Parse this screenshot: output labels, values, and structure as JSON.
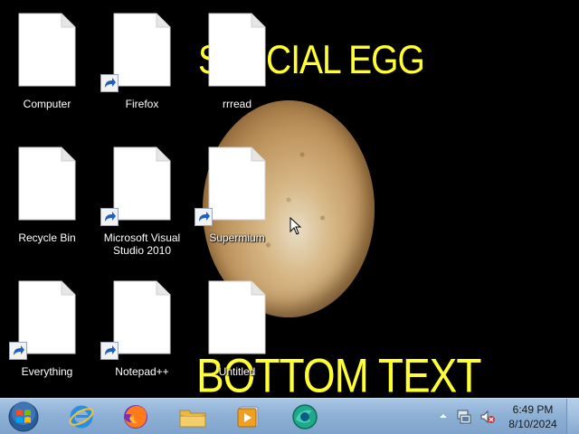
{
  "wallpaper": {
    "top_text": "SPECIAL EGG",
    "bottom_text": "BOTTOM TEXT",
    "text_color": "#ffff33",
    "background_color": "#000000"
  },
  "desktop": {
    "icons": [
      {
        "label": "Computer",
        "shortcut": false
      },
      {
        "label": "Recycle Bin",
        "shortcut": false
      },
      {
        "label": "Everything",
        "shortcut": true
      },
      {
        "label": "Firefox",
        "shortcut": true
      },
      {
        "label": "Microsoft Visual Studio 2010",
        "shortcut": true
      },
      {
        "label": "Notepad++",
        "shortcut": true
      },
      {
        "label": "rrread",
        "shortcut": false
      },
      {
        "label": "Supermium",
        "shortcut": true
      },
      {
        "label": "Untitled",
        "shortcut": false
      }
    ]
  },
  "taskbar": {
    "pinned_apps": [
      {
        "icon": "internet-explorer-icon"
      },
      {
        "icon": "firefox-icon"
      },
      {
        "icon": "file-explorer-icon"
      },
      {
        "icon": "media-player-icon"
      },
      {
        "icon": "supermium-icon"
      }
    ],
    "tray": {
      "time": "6:49 PM",
      "date": "8/10/2024"
    },
    "colors": {
      "bar": "#8fb1d6"
    }
  }
}
